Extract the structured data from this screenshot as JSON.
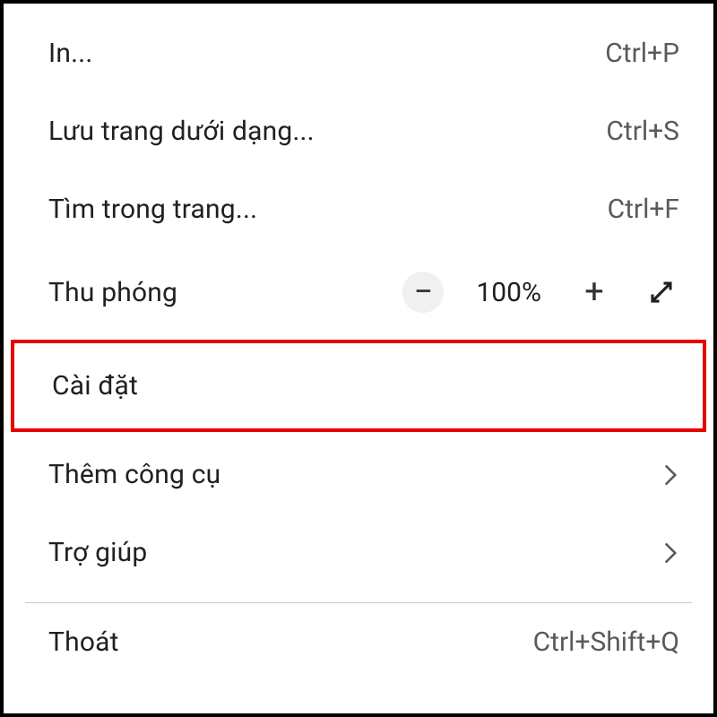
{
  "menu": {
    "print": {
      "label": "In...",
      "shortcut": "Ctrl+P"
    },
    "savePage": {
      "label": "Lưu trang dưới dạng...",
      "shortcut": "Ctrl+S"
    },
    "findInPage": {
      "label": "Tìm trong trang...",
      "shortcut": "Ctrl+F"
    },
    "zoom": {
      "label": "Thu phóng",
      "value": "100%"
    },
    "settings": {
      "label": "Cài đặt"
    },
    "moreTools": {
      "label": "Thêm công cụ"
    },
    "help": {
      "label": "Trợ giúp"
    },
    "exit": {
      "label": "Thoát",
      "shortcut": "Ctrl+Shift+Q"
    }
  },
  "icons": {
    "minus": "−",
    "plus": "+"
  }
}
